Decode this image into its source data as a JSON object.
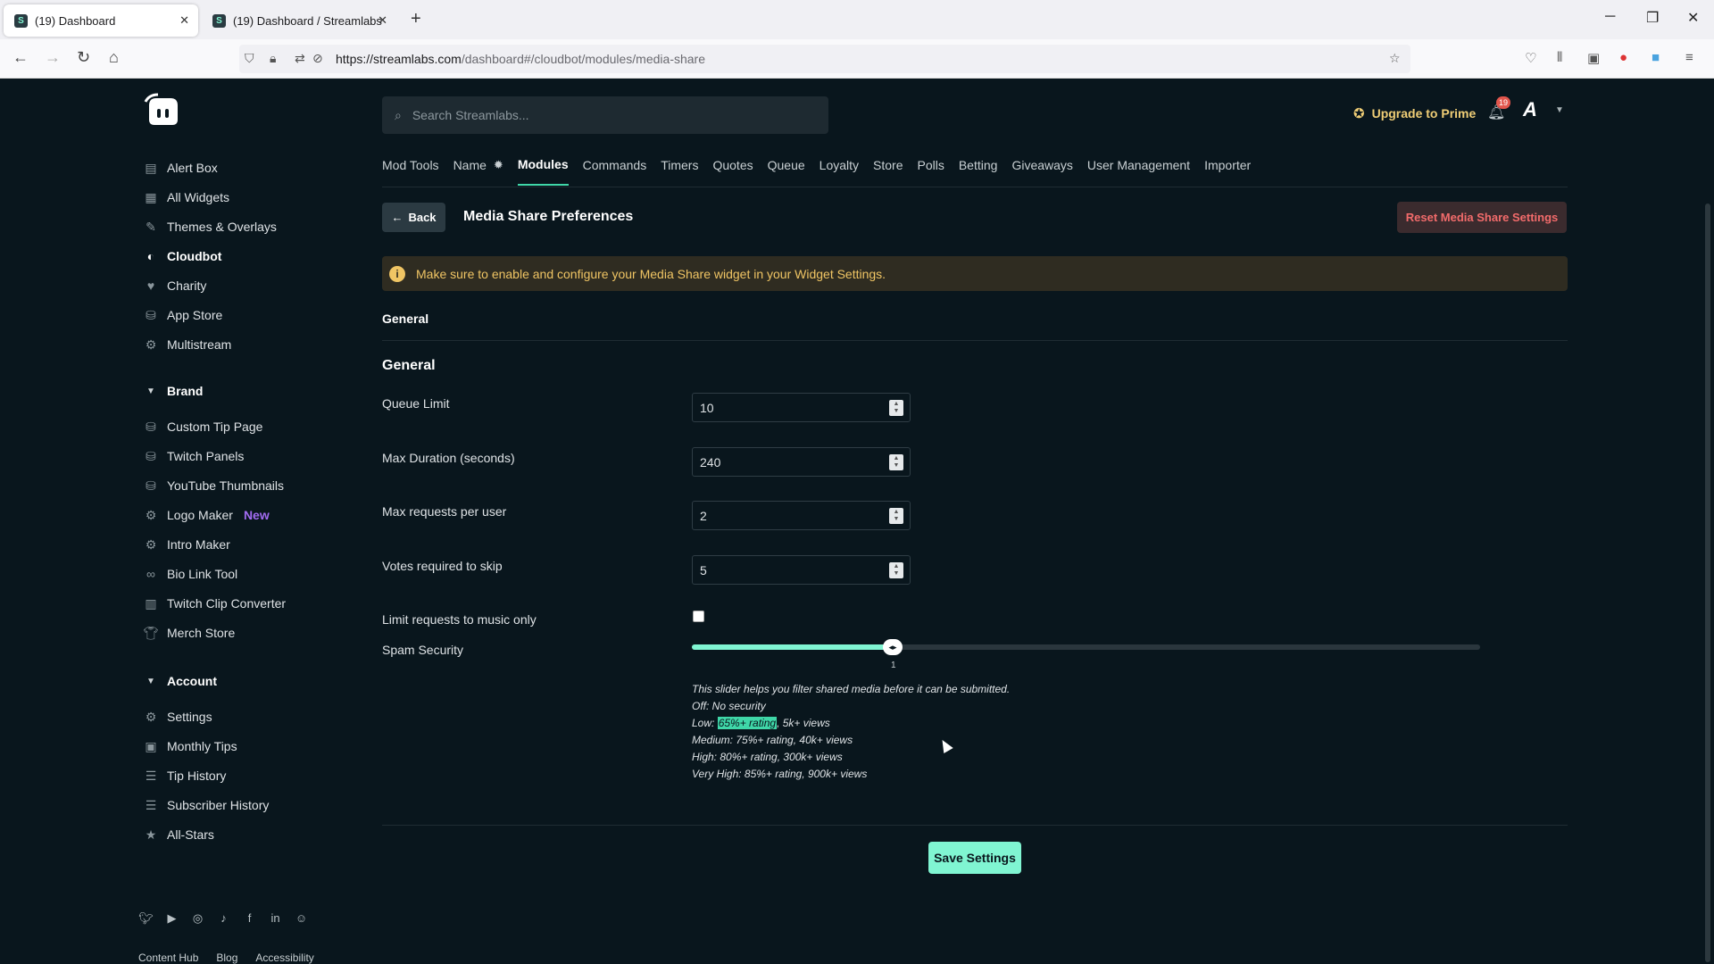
{
  "browser": {
    "tabs": [
      {
        "title": "(19) Dashboard"
      },
      {
        "title": "(19) Dashboard / Streamlabs"
      }
    ],
    "url_host": "https://streamlabs.com",
    "url_path": "/dashboard#/cloudbot/modules/media-share"
  },
  "sidebar": {
    "items": [
      {
        "label": "Alert Box",
        "icon": "alert-box-icon"
      },
      {
        "label": "All Widgets",
        "icon": "widgets-icon"
      },
      {
        "label": "Themes & Overlays",
        "icon": "themes-icon"
      },
      {
        "label": "Cloudbot",
        "icon": "cloudbot-icon"
      },
      {
        "label": "Charity",
        "icon": "heart-icon"
      },
      {
        "label": "App Store",
        "icon": "app-store-icon"
      },
      {
        "label": "Multistream",
        "icon": "multistream-icon"
      }
    ],
    "brand_header": "Brand",
    "brand_items": [
      {
        "label": "Custom Tip Page"
      },
      {
        "label": "Twitch Panels"
      },
      {
        "label": "YouTube Thumbnails"
      },
      {
        "label": "Logo Maker",
        "badge": "New"
      },
      {
        "label": "Intro Maker"
      },
      {
        "label": "Bio Link Tool"
      },
      {
        "label": "Twitch Clip Converter"
      },
      {
        "label": "Merch Store"
      }
    ],
    "account_header": "Account",
    "account_items": [
      {
        "label": "Settings"
      },
      {
        "label": "Monthly Tips"
      },
      {
        "label": "Tip History"
      },
      {
        "label": "Subscriber History"
      },
      {
        "label": "All-Stars"
      }
    ],
    "footer_links": [
      "Content Hub",
      "Blog",
      "Accessibility"
    ]
  },
  "header": {
    "search_placeholder": "Search Streamlabs...",
    "upgrade_label": "Upgrade to Prime",
    "notification_count": "19"
  },
  "module_tabs": [
    "Mod Tools",
    "Name",
    "Modules",
    "Commands",
    "Timers",
    "Quotes",
    "Queue",
    "Loyalty",
    "Store",
    "Polls",
    "Betting",
    "Giveaways",
    "User Management",
    "Importer"
  ],
  "main": {
    "back_label": "Back",
    "title": "Media Share Preferences",
    "reset_label": "Reset Media Share Settings",
    "notice": "Make sure to enable and configure your Media Share widget in your Widget Settings.",
    "section_tab": "General",
    "section_title": "General",
    "fields": [
      {
        "label": "Queue Limit",
        "value": "10"
      },
      {
        "label": "Max Duration (seconds)",
        "value": "240"
      },
      {
        "label": "Max requests per user",
        "value": "2"
      },
      {
        "label": "Votes required to skip",
        "value": "5"
      }
    ],
    "music_only_label": "Limit requests to music only",
    "music_only_checked": false,
    "spam_label": "Spam Security",
    "spam_value": "1",
    "spam_fraction": 0.255,
    "help": {
      "intro": "This slider helps you filter shared media before it can be submitted.",
      "off": "Off: No security",
      "low_prefix": "Low: ",
      "low_highlight": "65%+ rating",
      "low_suffix": ", 5k+ views",
      "medium": "Medium: 75%+ rating, 40k+ views",
      "high": "High: 80%+ rating, 300k+ views",
      "very_high": "Very High: 85%+ rating, 900k+ views"
    },
    "save_label": "Save Settings"
  },
  "colors": {
    "background": "#09161d",
    "accent": "#80f5d2",
    "warning": "#f0c564",
    "danger": "#f26b6b"
  }
}
